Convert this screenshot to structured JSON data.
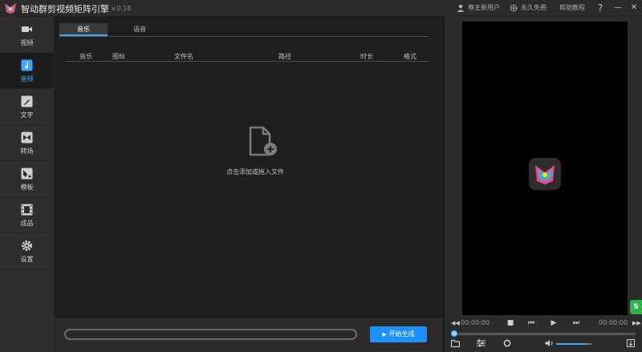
{
  "titlebar": {
    "app_title": "智动群剪视频矩阵引擎",
    "version": "v.0.18",
    "user_label": "尊主新用户",
    "license_label": "永久免费",
    "help_label": "帮助教程",
    "question_glyph": "?",
    "minimize_glyph": "—",
    "close_glyph": "✕"
  },
  "sidebar": {
    "items": [
      {
        "label": "视频",
        "icon": "video-camera-icon"
      },
      {
        "label": "音频",
        "icon": "music-note-icon"
      },
      {
        "label": "文字",
        "icon": "pencil-icon"
      },
      {
        "label": "转场",
        "icon": "transition-icon"
      },
      {
        "label": "模板",
        "icon": "template-icon"
      },
      {
        "label": "成品",
        "icon": "film-icon"
      },
      {
        "label": "设置",
        "icon": "gear-icon"
      }
    ],
    "active_index": 1
  },
  "tabs": [
    {
      "label": "音乐"
    },
    {
      "label": "语音"
    }
  ],
  "table": {
    "columns": [
      "音乐",
      "图标",
      "文件名",
      "路径",
      "时长",
      "格式"
    ]
  },
  "empty_state": {
    "hint": "点击添加或拖入文件",
    "icon": "add-file-icon"
  },
  "bottom": {
    "progress": 0,
    "start_label": "开始生成",
    "start_glyph": "▶"
  },
  "preview": {
    "time_start": "00:00:00",
    "time_end": "00:00:00",
    "corner_badge": "S"
  },
  "colors": {
    "accent": "#3fa7ff",
    "button": "#1e8fff",
    "background": "#1f1f1f"
  }
}
